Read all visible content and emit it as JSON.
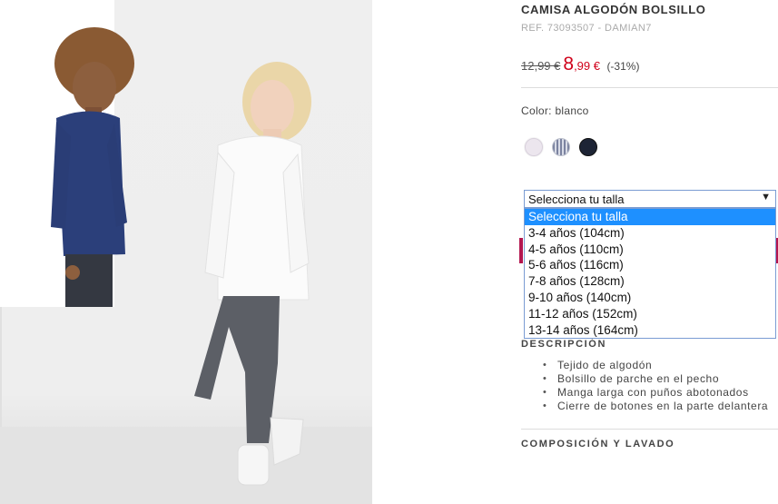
{
  "product": {
    "title": "CAMISA ALGODÓN BOLSILLO",
    "ref": "REF. 73093507 - DAMIAN7",
    "old_price": "12,99 €",
    "new_price_int": "8",
    "new_price_dec": ",99 €",
    "discount": "(-31%)",
    "color_label": "Color: blanco",
    "colors": [
      {
        "name": "blanco",
        "hex": "#ece6ee"
      },
      {
        "name": "rayas",
        "hex": "#7b83a0"
      },
      {
        "name": "marino",
        "hex": "#1d2435"
      }
    ]
  },
  "size_select": {
    "value": "Selecciona tu talla",
    "arrow": "▼",
    "options": [
      "Selecciona tu talla",
      "3-4 años (104cm)",
      "4-5 años (110cm)",
      "5-6 años (116cm)",
      "7-8 años (128cm)",
      "9-10 años (140cm)",
      "11-12 años (152cm)",
      "13-14 años (164cm)"
    ]
  },
  "description": {
    "title": "DESCRIPCIÓN",
    "items": [
      "Tejido de algodón",
      "Bolsillo de parche en el pecho",
      "Manga larga con puños abotonados",
      "Cierre de botones en la parte delantera"
    ]
  },
  "composition": {
    "title": "COMPOSICIÓN Y LAVADO"
  },
  "colors": {
    "accent_red": "#d0021b",
    "select_highlight": "#1e90ff",
    "add_button": "#b3164f"
  }
}
